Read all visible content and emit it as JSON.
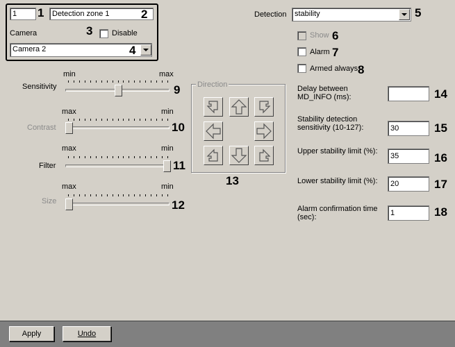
{
  "zone": {
    "number": "1",
    "name": "Detection zone 1",
    "camera_label": "Camera",
    "disable_label": "Disable",
    "camera_value": "Camera 2"
  },
  "detection": {
    "label": "Detection",
    "value": "stability",
    "show_label": "Show",
    "alarm_label": "Alarm",
    "armed_always_label": "Armed always"
  },
  "sliders": {
    "sensitivity": {
      "label": "Sensitivity",
      "left": "min",
      "right": "max",
      "level": 0.5
    },
    "contrast": {
      "label": "Contrast",
      "left": "max",
      "right": "min",
      "level": 0.0
    },
    "filter": {
      "label": "Filter",
      "left": "max",
      "right": "min",
      "level": 1.0
    },
    "size": {
      "label": "Size",
      "left": "max",
      "right": "min",
      "level": 0.0
    }
  },
  "direction": {
    "title": "Direction"
  },
  "fields": {
    "delay_label": "Delay between MD_INFO (ms):",
    "delay_value": "",
    "stability_sens_label": "Stability detection sensitivity (10-127):",
    "stability_sens_value": "30",
    "upper_label": "Upper stability limit (%):",
    "upper_value": "35",
    "lower_label": "Lower stability limit (%):",
    "lower_value": "20",
    "alarm_conf_label": "Alarm confirmation time (sec):",
    "alarm_conf_value": "1"
  },
  "callouts": {
    "c1": "1",
    "c2": "2",
    "c3": "3",
    "c4": "4",
    "c5": "5",
    "c6": "6",
    "c7": "7",
    "c8": "8",
    "c9": "9",
    "c10": "10",
    "c11": "11",
    "c12": "12",
    "c13": "13",
    "c14": "14",
    "c15": "15",
    "c16": "16",
    "c17": "17",
    "c18": "18"
  },
  "buttons": {
    "apply": "Apply",
    "undo": "Undo"
  }
}
